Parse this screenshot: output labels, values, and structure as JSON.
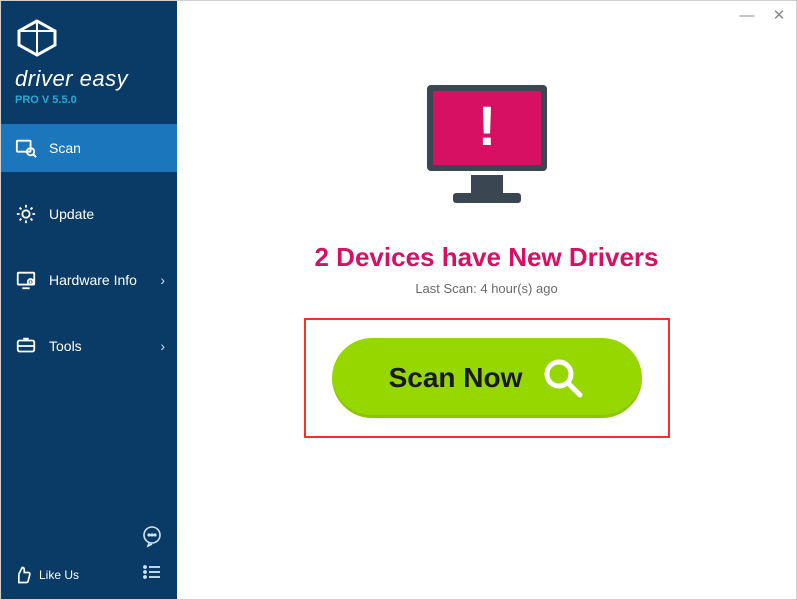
{
  "brand": {
    "name": "driver easy",
    "version": "PRO V 5.5.0"
  },
  "sidebar": {
    "items": [
      {
        "label": "Scan",
        "icon": "scan-icon",
        "active": true,
        "hasSubmenu": false
      },
      {
        "label": "Update",
        "icon": "update-icon",
        "active": false,
        "hasSubmenu": false
      },
      {
        "label": "Hardware Info",
        "icon": "hardware-icon",
        "active": false,
        "hasSubmenu": true
      },
      {
        "label": "Tools",
        "icon": "tools-icon",
        "active": false,
        "hasSubmenu": true
      }
    ],
    "likeUs": "Like Us"
  },
  "main": {
    "headline": "2 Devices have New Drivers",
    "lastScan": "Last Scan: 4 hour(s) ago",
    "scanButton": "Scan Now"
  },
  "colors": {
    "accent": "#d81064",
    "sidebar": "#0a3a66",
    "sidebarActive": "#1b76bc",
    "scanButton": "#97d700",
    "highlightBorder": "#ff2b2b"
  }
}
